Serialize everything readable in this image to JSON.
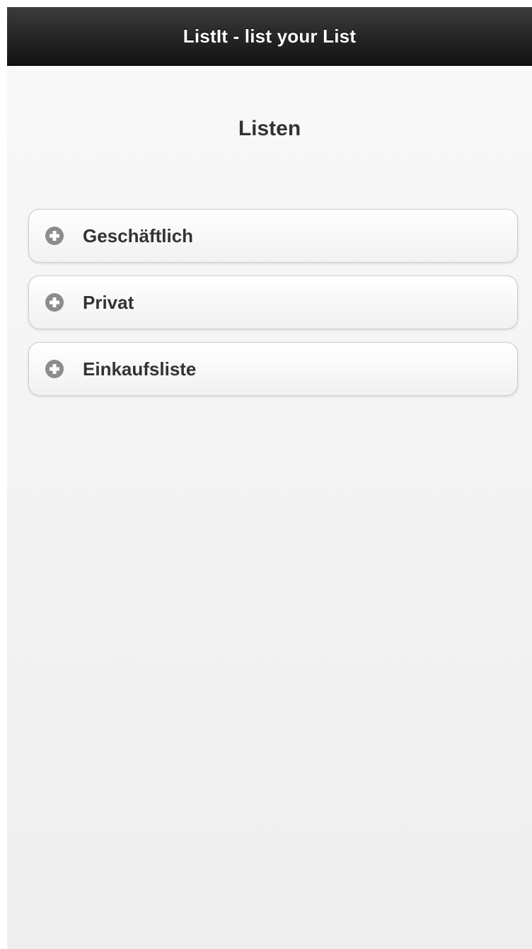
{
  "header": {
    "title": "ListIt - list your List"
  },
  "page": {
    "title": "Listen"
  },
  "lists": [
    {
      "label": "Geschäftlich",
      "icon": "plus-circle-icon"
    },
    {
      "label": "Privat",
      "icon": "plus-circle-icon"
    },
    {
      "label": "Einkaufsliste",
      "icon": "plus-circle-icon"
    }
  ],
  "colors": {
    "header_bg": "#1a1a1a",
    "icon_gray": "#8c8c8c",
    "text_dark": "#333333"
  }
}
